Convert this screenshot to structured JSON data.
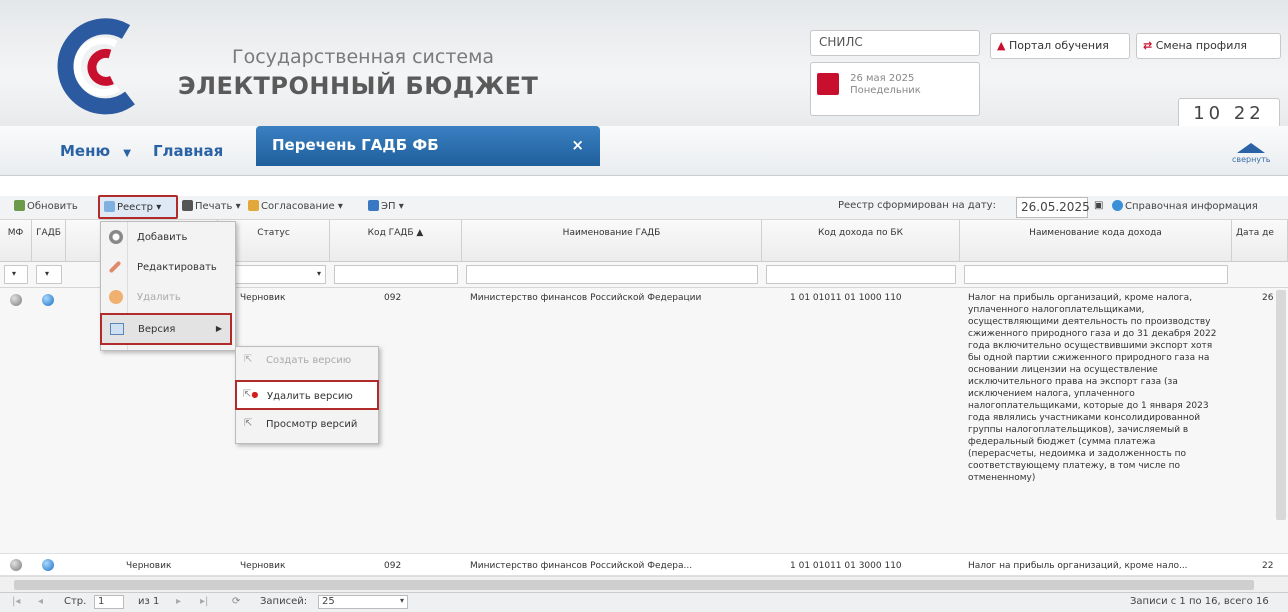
{
  "header": {
    "title_line1": "Государственная система",
    "title_line2": "ЭЛЕКТРОННЫЙ БЮДЖЕТ",
    "snils_label": "СНИЛС",
    "date": "26 мая 2025",
    "weekday": "Понедельник",
    "portal_button": "Портал обучения",
    "change_profile_button": "Смена профиля",
    "time_hours": "10",
    "time_minutes": "22"
  },
  "nav": {
    "menu": "Меню",
    "home": "Главная",
    "active_tab": "Перечень ГАДБ ФБ",
    "tab_close": "×",
    "collapse": "свернуть"
  },
  "toolbar": {
    "refresh": "Обновить",
    "registry": "Реестр",
    "print": "Печать",
    "approval": "Согласование",
    "signature": "ЭП",
    "formed_on_label": "Реестр сформирован на дату:",
    "formed_on_date": "26.05.2025",
    "help": "Справочная информация"
  },
  "table": {
    "columns": [
      "МФ",
      "ГАДБ",
      "Статус",
      "Код ГАДБ",
      "Наименование ГАДБ",
      "Код дохода по БК",
      "Наименование кода дохода",
      "Дата де"
    ],
    "rows": [
      {
        "status": "Черновик",
        "code": "092",
        "name": "Министерство финансов Российской Федерации",
        "income_code": "1 01 01011 01 1000 110",
        "income_name": "Налог на прибыль организаций, кроме налога, уплаченного налогоплательщиками, осуществляющими деятельность по производству сжиженного природного газа и до 31 декабря 2022 года включительно осуществившими экспорт хотя бы одной партии сжиженного природного газа на основании лицензии на осуществление исключительного права на экспорт газа (за исключением налога, уплаченного налогоплательщиками, которые до 1 января 2023 года являлись участниками консолидированной группы налогоплательщиков), зачисляемый в федеральный бюджет (сумма платежа (перерасчеты, недоимка и задолженность по соответствующему платежу, в том числе по отмененному)",
        "date": "26"
      },
      {
        "gadb_status": "Черновик",
        "status": "Черновик",
        "code": "092",
        "name": "Министерство финансов Российской Федера...",
        "income_code": "1 01 01011 01 3000 110",
        "income_name": "Налог на прибыль организаций, кроме нало...",
        "date": "22"
      }
    ]
  },
  "context_menu": {
    "add": "Добавить",
    "edit": "Редактировать",
    "delete": "Удалить",
    "version": "Версия"
  },
  "version_submenu": {
    "create": "Создать версию",
    "delete": "Удалить версию",
    "view": "Просмотр версий"
  },
  "pager": {
    "page_label": "Стр.",
    "page": "1",
    "of_label": "из 1",
    "records_label": "Записей:",
    "records_per_page": "25",
    "summary": "Записи с 1 по 16, всего 16"
  },
  "colors": {
    "brand_blue": "#2a62a6",
    "active_tab": "#1f5f9c",
    "highlight_red": "#b22b2b"
  }
}
